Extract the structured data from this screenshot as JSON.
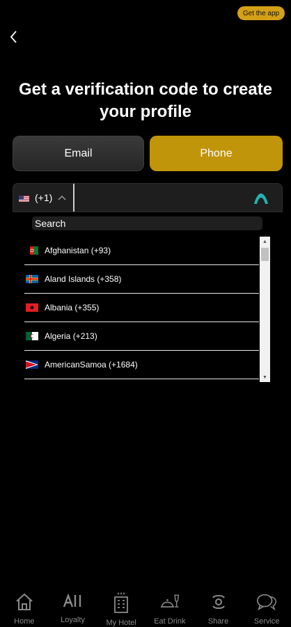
{
  "header": {
    "back_icon": "chevron-left-icon",
    "get_app_label": "Get the app",
    "accent_color": "#d4a017"
  },
  "title": {
    "line1": "Get a verification code to create",
    "line2": "your profile"
  },
  "tabs": [
    {
      "label": "Email",
      "selected": false
    },
    {
      "label": "Phone",
      "selected": true
    }
  ],
  "phone": {
    "country_code": "(+1)",
    "country_flag": "us-flag-icon",
    "value": "",
    "placeholder": ""
  },
  "dropdown": {
    "search_placeholder": "Search",
    "countries": [
      {
        "label": "Afghanistan (+93)",
        "flag": "afghanistan-flag-icon"
      },
      {
        "label": "Aland Islands (+358)",
        "flag": "aland-islands-flag-icon"
      },
      {
        "label": "Albania (+355)",
        "flag": "albania-flag-icon"
      },
      {
        "label": "Algeria (+213)",
        "flag": "algeria-flag-icon"
      },
      {
        "label": "AmericanSamoa (+1684)",
        "flag": "american-samoa-flag-icon"
      }
    ]
  },
  "bottom_nav": [
    {
      "label": "Home",
      "icon": "home-icon"
    },
    {
      "label": "Loyalty",
      "icon": "all-loyalty-icon"
    },
    {
      "label": "My Hotel",
      "icon": "hotel-icon"
    },
    {
      "label": "Eat Drink",
      "icon": "cloche-icon"
    },
    {
      "label": "Share",
      "icon": "share-icon"
    },
    {
      "label": "Service",
      "icon": "chat-icon"
    }
  ]
}
